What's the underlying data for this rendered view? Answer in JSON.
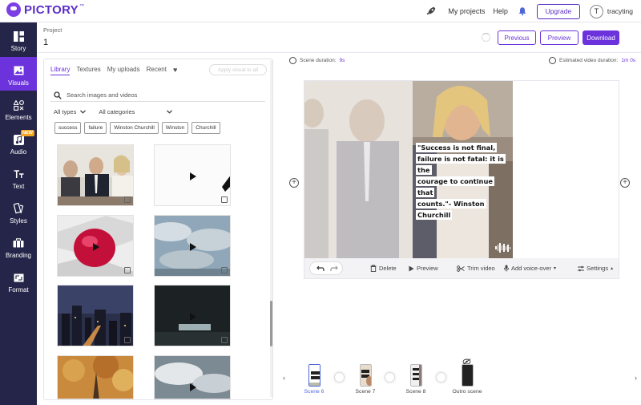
{
  "app": {
    "brand": "PICTORY",
    "brand_mark": "™",
    "brand_color": "#5a2ec7",
    "accent_color": "#6c33dd",
    "sidebar_color": "#25254a"
  },
  "topbar": {
    "my_projects": "My projects",
    "help": "Help",
    "upgrade": "Upgrade",
    "avatar_initial": "T",
    "username": "tracyting"
  },
  "sidebar": {
    "items": [
      {
        "label": "Story",
        "icon": "story-icon"
      },
      {
        "label": "Visuals",
        "icon": "visuals-icon"
      },
      {
        "label": "Elements",
        "icon": "elements-icon"
      },
      {
        "label": "Audio",
        "icon": "audio-icon",
        "badge": "NEW"
      },
      {
        "label": "Text",
        "icon": "text-icon"
      },
      {
        "label": "Styles",
        "icon": "styles-icon"
      },
      {
        "label": "Branding",
        "icon": "branding-icon"
      },
      {
        "label": "Format",
        "icon": "format-icon"
      }
    ]
  },
  "project": {
    "label": "Project",
    "name": "1",
    "previous": "Previous",
    "preview": "Preview",
    "download": "Download"
  },
  "library": {
    "tabs": [
      "Library",
      "Textures",
      "My uploads",
      "Recent"
    ],
    "apply_all": "Apply visual to all",
    "search_placeholder": "Search images and videos",
    "type_filter": "All types",
    "category_filter": "All categories",
    "chips": [
      "success",
      "failure",
      "Winston Churchill",
      "Winston",
      "Churchill"
    ]
  },
  "editor": {
    "scene_duration_label": "Scene duration:",
    "scene_duration_value": "9s",
    "estimated_label": "Estimated video duration:",
    "estimated_value": "1m 0s",
    "quote_lines": [
      "\"Success is not final,",
      "failure is not fatal: it is the",
      "courage to continue that",
      "counts.\"- Winston",
      "Churchill"
    ]
  },
  "toolbar": {
    "delete": "Delete",
    "preview": "Preview",
    "trim": "Trim video",
    "voice": "Add voice-over",
    "settings": "Settings"
  },
  "timeline": {
    "scenes": [
      {
        "label": "Scene 6",
        "active": true
      },
      {
        "label": "Scene 7",
        "active": false
      },
      {
        "label": "Scene 8",
        "active": false
      },
      {
        "label": "Outro scene",
        "active": false
      }
    ]
  }
}
